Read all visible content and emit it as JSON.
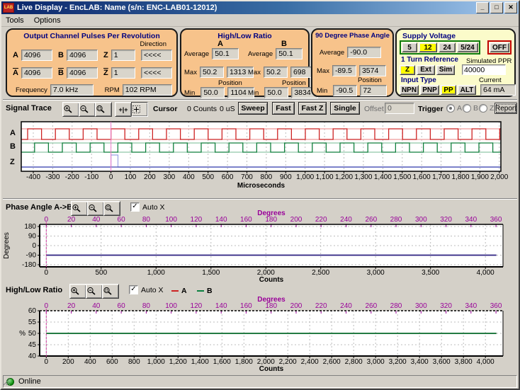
{
  "window": {
    "icon_text": "LAB",
    "title": "Live Display - EncLAB: Name (s/n: ENC-LAB01-12012)",
    "buttons": {
      "minimize": "_",
      "maximize": "□",
      "close": "✕"
    }
  },
  "menu": {
    "items": [
      {
        "label": "Tools"
      },
      {
        "label": "Options"
      }
    ]
  },
  "output_panel": {
    "title": "Output Channel Pulses Per Revolution",
    "direction_label": "Direction",
    "a_label": "A",
    "a": "4096",
    "b_label": "B",
    "b": "4096",
    "z_label": "Z",
    "z": "1",
    "dir1": "<<<<",
    "abar_label": "A",
    "abar": "4096",
    "bbar_label": "B",
    "bbar": "4096",
    "zbar_label": "Z",
    "zbar": "1",
    "dir2": "<<<<",
    "frequency_label": "Frequency",
    "frequency": "7.0 kHz",
    "rpm_label": "RPM",
    "rpm": "102 RPM"
  },
  "ratio_panel": {
    "title": "High/Low Ratio",
    "col_a": "A",
    "col_b": "B",
    "average_label": "Average",
    "max_label": "Max",
    "min_label": "Min",
    "position_label": "Position",
    "a_avg": "50.1",
    "a_max": "50.2",
    "a_max_pos": "1313",
    "a_min": "50.0",
    "a_min_pos": "1104",
    "b_avg": "50.1",
    "b_max": "50.2",
    "b_max_pos": "698",
    "b_min": "50.0",
    "b_min_pos": "3834"
  },
  "phase_panel": {
    "title": "90 Degree Phase Angle",
    "average_label": "Average",
    "avg": "-90.0",
    "max_label": "Max",
    "max": "-89.5",
    "max_pos": "3574",
    "position_label": "Position",
    "min_label": "Min",
    "min": "-90.5",
    "min_pos": "72"
  },
  "supply_panel": {
    "title": "Supply Voltage",
    "voltage_buttons": [
      "5",
      "12",
      "24",
      "5/24"
    ],
    "active_voltage": "12",
    "off_label": "OFF",
    "turn_ref_label": "1 Turn Reference",
    "turn_ref_buttons": [
      "Z",
      "Ext",
      "Sim"
    ],
    "active_turn_ref": "Z",
    "simulated_ppr_label": "Simulated PPR",
    "simulated_ppr": "40000",
    "input_type_label": "Input Type",
    "input_type_buttons": [
      "NPN",
      "PNP",
      "PP",
      "ALT"
    ],
    "active_input_type": "PP",
    "current_label": "Current",
    "current": "64 mA"
  },
  "signal_trace_header": {
    "title": "Signal Trace",
    "cursor_label": "Cursor",
    "cursor_counts": "0 Counts",
    "cursor_time": "0 uS",
    "sweep": "Sweep",
    "fast": "Fast",
    "fast_z": "Fast Z",
    "single": "Single",
    "offset_label": "Offset",
    "offset_value": "0",
    "trigger_label": "Trigger",
    "trigger_options": [
      "A",
      "B",
      "Z"
    ],
    "trigger_selected": "A",
    "report": "Report"
  },
  "phase_header": {
    "title": "Phase Angle A->B",
    "auto_x": "Auto X",
    "auto_x_checked": "✓"
  },
  "ratio_header": {
    "title": "High/Low Ratio",
    "auto_x": "Auto X",
    "auto_x_checked": "✓",
    "legend": [
      {
        "label": "A",
        "color": "#cc2222"
      },
      {
        "label": "B",
        "color": "#0a8040"
      }
    ]
  },
  "status_bar": {
    "text": "Online"
  },
  "chart_data": [
    {
      "name": "signal_trace",
      "type": "line",
      "xlabel": "Microseconds",
      "x_range": [
        -462,
        2008
      ],
      "x_ticks": [
        -400,
        -300,
        -200,
        -100,
        0,
        100,
        200,
        300,
        400,
        500,
        600,
        700,
        800,
        900,
        1000,
        1100,
        1200,
        1300,
        1400,
        1500,
        1600,
        1700,
        1800,
        1900,
        2000
      ],
      "channels": [
        {
          "label": "A",
          "kind": "square",
          "period_us": 143,
          "duty": 0.5,
          "rise_at_us": 0,
          "color": "#cc2020",
          "complement_color": "#ef9a9a"
        },
        {
          "label": "B",
          "kind": "square",
          "period_us": 143,
          "duty": 0.5,
          "rise_at_us": 35.75,
          "color": "#0e7d3a",
          "complement_color": "#8fc6a6"
        },
        {
          "label": "Z",
          "kind": "pulse",
          "pulse_start_us": 0,
          "pulse_width_us": 36,
          "color": "#3c46b0",
          "complement_color": "#9aa2e6"
        }
      ],
      "cursor": {
        "x": 0,
        "color": "#ee7ccc"
      }
    },
    {
      "name": "phase_angle_a_to_b",
      "type": "line",
      "top_axis": {
        "title": "Degrees",
        "ticks": [
          0,
          20,
          40,
          60,
          80,
          100,
          120,
          140,
          160,
          180,
          200,
          220,
          240,
          260,
          280,
          300,
          320,
          340,
          360
        ],
        "counts_per_360": 4096,
        "color": "#990099"
      },
      "ylabel": "Degrees",
      "ylabel_rotated": true,
      "y_ticks": [
        180,
        90,
        0,
        -90,
        -180
      ],
      "ylim": [
        -200,
        200
      ],
      "xlabel": "Counts",
      "x_range": [
        -60,
        4160
      ],
      "x_ticks": [
        0,
        500,
        1000,
        1500,
        2000,
        2500,
        3000,
        3500,
        4000
      ],
      "series": [
        {
          "name": "Phase A->B",
          "color": "#2d2080",
          "value": -90,
          "x_start": 0,
          "x_end": 4100
        }
      ],
      "cursor": {
        "x": 0,
        "color": "#cc3399"
      },
      "top_border_dashed": false
    },
    {
      "name": "high_low_ratio",
      "type": "line",
      "top_axis": {
        "title": "Degrees",
        "ticks": [
          0,
          20,
          40,
          60,
          80,
          100,
          120,
          140,
          160,
          180,
          200,
          220,
          240,
          260,
          280,
          300,
          320,
          340,
          360
        ],
        "counts_per_360": 4096,
        "color": "#990099"
      },
      "ylabel": "%",
      "ylabel_rotated": false,
      "y_ticks": [
        60,
        55,
        50,
        45,
        40
      ],
      "ylim": [
        40,
        60
      ],
      "xlabel": "Counts",
      "x_range": [
        -60,
        4160
      ],
      "x_ticks": [
        0,
        200,
        400,
        600,
        800,
        1000,
        1200,
        1400,
        1600,
        1800,
        2000,
        2200,
        2400,
        2600,
        2800,
        3000,
        3200,
        3400,
        3600,
        3800,
        4000
      ],
      "series": [
        {
          "name": "A",
          "color": "#cc2222",
          "value": 50,
          "x_start": 0,
          "x_end": 4100
        },
        {
          "name": "B",
          "color": "#0a8040",
          "value": 50,
          "x_start": 0,
          "x_end": 4100
        }
      ],
      "cursor": {
        "x": 0,
        "color": "#cc3399"
      },
      "top_border_dashed": true
    }
  ]
}
